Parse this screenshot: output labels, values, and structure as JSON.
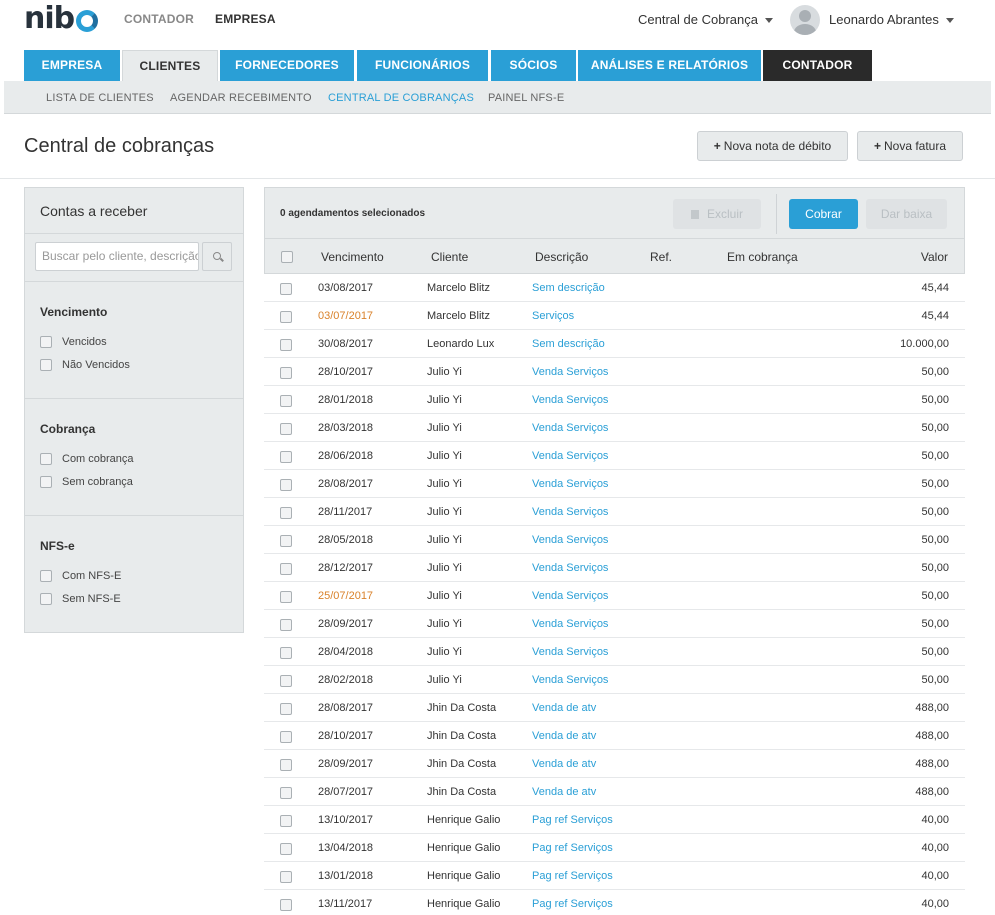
{
  "brand": {
    "logo_text": "nib",
    "accent": "#2a9fd6"
  },
  "topbar": {
    "contador_label": "CONTADOR",
    "empresa_label": "EMPRESA",
    "module_dropdown": "Central de Cobrança",
    "user_name": "Leonardo Abrantes"
  },
  "tabs": [
    {
      "label": "EMPRESA"
    },
    {
      "label": "CLIENTES"
    },
    {
      "label": "FORNECEDORES"
    },
    {
      "label": "FUNCIONÁRIOS"
    },
    {
      "label": "SÓCIOS"
    },
    {
      "label": "ANÁLISES E RELATÓRIOS"
    },
    {
      "label": "CONTADOR"
    }
  ],
  "subnav": [
    {
      "label": "LISTA DE CLIENTES"
    },
    {
      "label": "AGENDAR RECEBIMENTO"
    },
    {
      "label": "CENTRAL DE COBRANÇAS"
    },
    {
      "label": "PAINEL NFS-E"
    }
  ],
  "header": {
    "title": "Central de cobranças",
    "new_debit_note": "Nova nota de débito",
    "new_invoice": "Nova fatura"
  },
  "sidebar": {
    "title": "Contas a receber",
    "search_placeholder": "Buscar pelo cliente, descrição",
    "groups": [
      {
        "title": "Vencimento",
        "options": [
          "Vencidos",
          "Não Vencidos"
        ]
      },
      {
        "title": "Cobrança",
        "options": [
          "Com cobrança",
          "Sem cobrança"
        ]
      },
      {
        "title": "NFS-e",
        "options": [
          "Com NFS-E",
          "Sem NFS-E"
        ]
      }
    ]
  },
  "toolbar": {
    "selection_text": "0 agendamentos selecionados",
    "delete_label": "Excluir",
    "charge_label": "Cobrar",
    "settle_label": "Dar baixa"
  },
  "table": {
    "columns": [
      "Vencimento",
      "Cliente",
      "Descrição",
      "Ref.",
      "Em cobrança",
      "Valor"
    ],
    "rows": [
      {
        "vencimento": "03/08/2017",
        "cliente": "Marcelo Blitz",
        "descricao": "Sem descrição",
        "valor": "45,44",
        "late": false
      },
      {
        "vencimento": "03/07/2017",
        "cliente": "Marcelo Blitz",
        "descricao": "Serviços",
        "valor": "45,44",
        "late": true
      },
      {
        "vencimento": "30/08/2017",
        "cliente": "Leonardo Lux",
        "descricao": "Sem descrição",
        "valor": "10.000,00",
        "late": false
      },
      {
        "vencimento": "28/10/2017",
        "cliente": "Julio Yi",
        "descricao": "Venda Serviços",
        "valor": "50,00",
        "late": false
      },
      {
        "vencimento": "28/01/2018",
        "cliente": "Julio Yi",
        "descricao": "Venda Serviços",
        "valor": "50,00",
        "late": false
      },
      {
        "vencimento": "28/03/2018",
        "cliente": "Julio Yi",
        "descricao": "Venda Serviços",
        "valor": "50,00",
        "late": false
      },
      {
        "vencimento": "28/06/2018",
        "cliente": "Julio Yi",
        "descricao": "Venda Serviços",
        "valor": "50,00",
        "late": false
      },
      {
        "vencimento": "28/08/2017",
        "cliente": "Julio Yi",
        "descricao": "Venda Serviços",
        "valor": "50,00",
        "late": false
      },
      {
        "vencimento": "28/11/2017",
        "cliente": "Julio Yi",
        "descricao": "Venda Serviços",
        "valor": "50,00",
        "late": false
      },
      {
        "vencimento": "28/05/2018",
        "cliente": "Julio Yi",
        "descricao": "Venda Serviços",
        "valor": "50,00",
        "late": false
      },
      {
        "vencimento": "28/12/2017",
        "cliente": "Julio Yi",
        "descricao": "Venda Serviços",
        "valor": "50,00",
        "late": false
      },
      {
        "vencimento": "25/07/2017",
        "cliente": "Julio Yi",
        "descricao": "Venda Serviços",
        "valor": "50,00",
        "late": true
      },
      {
        "vencimento": "28/09/2017",
        "cliente": "Julio Yi",
        "descricao": "Venda Serviços",
        "valor": "50,00",
        "late": false
      },
      {
        "vencimento": "28/04/2018",
        "cliente": "Julio Yi",
        "descricao": "Venda Serviços",
        "valor": "50,00",
        "late": false
      },
      {
        "vencimento": "28/02/2018",
        "cliente": "Julio Yi",
        "descricao": "Venda Serviços",
        "valor": "50,00",
        "late": false
      },
      {
        "vencimento": "28/08/2017",
        "cliente": "Jhin Da Costa",
        "descricao": "Venda de atv",
        "valor": "488,00",
        "late": false
      },
      {
        "vencimento": "28/10/2017",
        "cliente": "Jhin Da Costa",
        "descricao": "Venda de atv",
        "valor": "488,00",
        "late": false
      },
      {
        "vencimento": "28/09/2017",
        "cliente": "Jhin Da Costa",
        "descricao": "Venda de atv",
        "valor": "488,00",
        "late": false
      },
      {
        "vencimento": "28/07/2017",
        "cliente": "Jhin Da Costa",
        "descricao": "Venda de atv",
        "valor": "488,00",
        "late": false
      },
      {
        "vencimento": "13/10/2017",
        "cliente": "Henrique Galio",
        "descricao": "Pag ref Serviços",
        "valor": "40,00",
        "late": false
      },
      {
        "vencimento": "13/04/2018",
        "cliente": "Henrique Galio",
        "descricao": "Pag ref Serviços",
        "valor": "40,00",
        "late": false
      },
      {
        "vencimento": "13/01/2018",
        "cliente": "Henrique Galio",
        "descricao": "Pag ref Serviços",
        "valor": "40,00",
        "late": false
      },
      {
        "vencimento": "13/11/2017",
        "cliente": "Henrique Galio",
        "descricao": "Pag ref Serviços",
        "valor": "40,00",
        "late": false
      }
    ]
  }
}
